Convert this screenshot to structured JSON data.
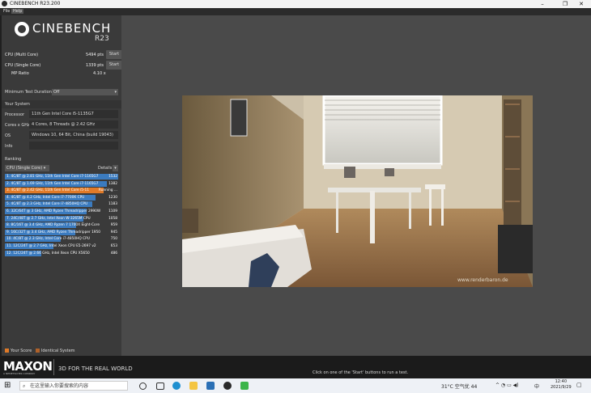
{
  "window": {
    "title": "CINEBENCH R23.200",
    "min": "–",
    "max": "❐",
    "close": "✕"
  },
  "menu": {
    "file": "File",
    "help": "Help"
  },
  "logo": {
    "name": "CINEBENCH",
    "version": "R23"
  },
  "benchmarks": [
    {
      "label": "CPU (Multi Core)",
      "value": "5494 pts",
      "button": "Start"
    },
    {
      "label": "CPU (Single Core)",
      "value": "1339 pts",
      "button": "Start"
    }
  ],
  "mp_ratio": {
    "label": "MP Ratio",
    "value": "4.10 x"
  },
  "min_duration": {
    "label": "Minimum Test Duration",
    "value": "Off"
  },
  "system": {
    "heading": "Your System",
    "rows": [
      {
        "key": "Processor",
        "value": "11th Gen Intel Core i5-1135G7"
      },
      {
        "key": "Cores x GHz",
        "value": "4 Cores, 8 Threads @ 2.42 GHz"
      },
      {
        "key": "OS",
        "value": "Windows 10, 64 Bit, China (build 19043)"
      },
      {
        "key": "Info",
        "value": ""
      }
    ]
  },
  "ranking": {
    "heading": "Ranking",
    "select": "CPU (Single Core)",
    "details": "Details",
    "items": [
      {
        "label": "1. 4C/8T @ 2.81 GHz, 11th Gen Intel Core i7-1165G7",
        "score": "1532",
        "fraction": 1.0,
        "color": "#3b7bbf"
      },
      {
        "label": "2. 4C/8T @ 1.69 GHz, 11th Gen Intel Core i7-1165G7",
        "score": "1382",
        "fraction": 0.9,
        "color": "#3b7bbf"
      },
      {
        "label": "3. 4C/8T @ 2.42 GHz, 11th Gen Intel Core i5-11",
        "score": "Running ...",
        "fraction": 0.87,
        "color": "#e07a28"
      },
      {
        "label": "4. 4C/8T @ 4.2 GHz, Intel Core i7-7700K CPU",
        "score": "1230",
        "fraction": 0.8,
        "color": "#3b7bbf"
      },
      {
        "label": "5. 4C/8T @ 2.3 GHz, Intel Core i7-4850HQ CPU",
        "score": "1183",
        "fraction": 0.77,
        "color": "#3b7bbf"
      },
      {
        "label": "6. 32C/64T @ 3 GHz, AMD Ryzen Threadripper 2990W",
        "score": "1109",
        "fraction": 0.72,
        "color": "#3b7bbf"
      },
      {
        "label": "7. 24C/48T @ 2.7 GHz, Intel Xeon W-3265M CPU",
        "score": "1058",
        "fraction": 0.69,
        "color": "#3b7bbf"
      },
      {
        "label": "8. 8C/16T @ 3.4 GHz, AMD Ryzen 7 1700X Eight-Core",
        "score": "959",
        "fraction": 0.63,
        "color": "#3b7bbf"
      },
      {
        "label": "9. 16C/32T @ 3.4 GHz, AMD Ryzen Threadripper 1950",
        "score": "945",
        "fraction": 0.62,
        "color": "#3b7bbf"
      },
      {
        "label": "10. 4C/8T @ 2.3 GHz, Intel Core i7-4850HQ CPU",
        "score": "750",
        "fraction": 0.49,
        "color": "#3b7bbf"
      },
      {
        "label": "11. 12C/24T @ 2.7 GHz, Intel Xeon CPU E5-2697 v2",
        "score": "653",
        "fraction": 0.43,
        "color": "#3b7bbf"
      },
      {
        "label": "12. 12C/24T @ 2.66 GHz, Intel Xeon CPU X5650",
        "score": "486",
        "fraction": 0.32,
        "color": "#3b7bbf"
      }
    ]
  },
  "legend": {
    "your_score": "Your Score",
    "identical": "Identical System",
    "your_color": "#e07a28",
    "identical_color": "#b0622a"
  },
  "footer": {
    "brand": "MAXON",
    "brand_sub": "A NEMETSCHEK COMPANY",
    "slogan": "3D FOR THE REAL WORLD",
    "status": "Click on one of the 'Start' buttons to run a test."
  },
  "render": {
    "watermark": "www.renderbaron.de"
  },
  "taskbar": {
    "search_placeholder": "在这里输入你要搜索的内容",
    "weather": "31°C  空气优 44",
    "time": "12:40",
    "date": "2021/9/29"
  }
}
